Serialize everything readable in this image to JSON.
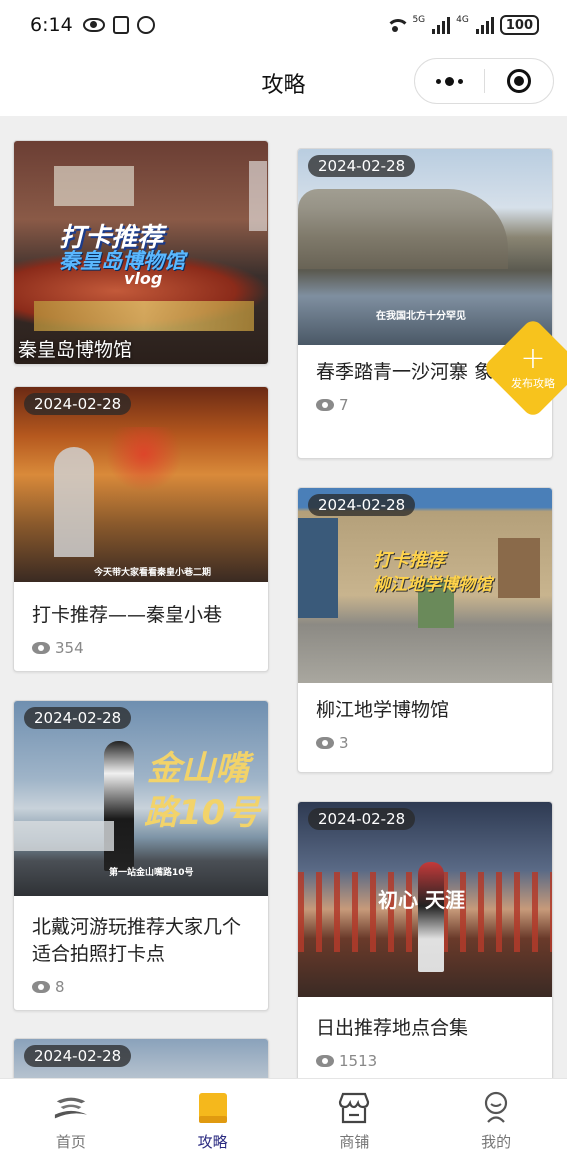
{
  "status_bar": {
    "time": "6:14",
    "battery": "100",
    "sig1": "5G",
    "sig2": "4G"
  },
  "nav": {
    "title": "攻略"
  },
  "publish": {
    "label": "发布攻略",
    "color": "#f7c31d"
  },
  "cards": [
    {
      "title": "秦皇岛博物馆",
      "date": "",
      "views": "",
      "overlay": [
        "打卡推荐",
        "秦皇岛博物馆",
        "vlog"
      ]
    },
    {
      "title": "春季踏青一沙河寨 象山",
      "date": "2024-02-28",
      "views": "7",
      "caption": "在我国北方十分罕见"
    },
    {
      "title": "打卡推荐——秦皇小巷",
      "date": "2024-02-28",
      "views": "354",
      "caption": "今天带大家看看秦皇小巷二期"
    },
    {
      "title": "柳江地学博物馆",
      "date": "2024-02-28",
      "views": "3",
      "overlay": [
        "打卡推荐",
        "柳江地学博物馆"
      ]
    },
    {
      "title": "北戴河游玩推荐大家几个适合拍照打卡点",
      "date": "2024-02-28",
      "views": "8",
      "overlay": [
        "金山嘴",
        "路10号"
      ],
      "caption": "第一站金山嘴路10号"
    },
    {
      "title": "日出推荐地点合集",
      "date": "2024-02-28",
      "views": "1513",
      "overlay": [
        "初心 天涯"
      ]
    },
    {
      "title": "",
      "date": "2024-02-28",
      "views": ""
    }
  ],
  "tabs": [
    {
      "label": "首页",
      "icon": "home-logo-icon"
    },
    {
      "label": "攻略",
      "icon": "book-icon",
      "active": true
    },
    {
      "label": "商铺",
      "icon": "shop-icon"
    },
    {
      "label": "我的",
      "icon": "user-icon"
    }
  ]
}
